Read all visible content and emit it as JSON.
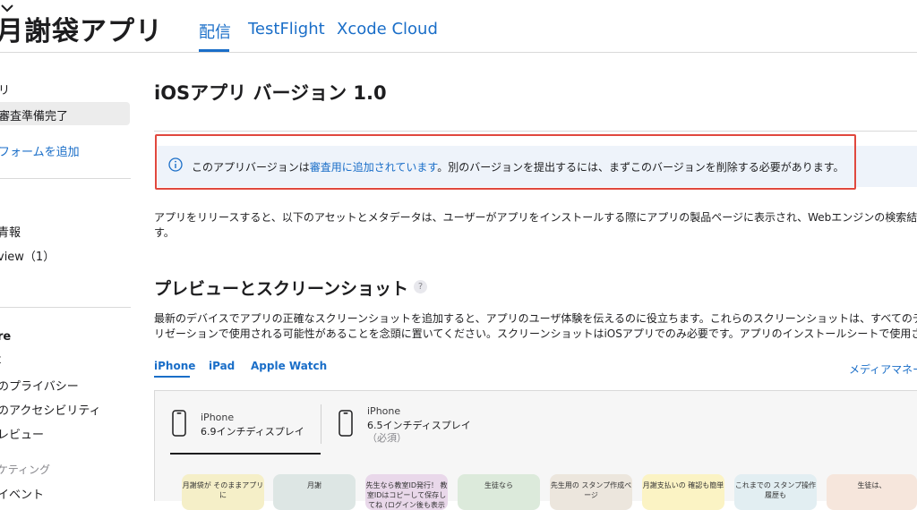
{
  "header": {
    "app_name": "月謝袋アプリ",
    "tabs": [
      {
        "label": "配信"
      },
      {
        "label": "TestFlight"
      },
      {
        "label": "Xcode Cloud"
      }
    ]
  },
  "sidebar": {
    "app_label": "リ",
    "status": "審査準備完了",
    "add_platform": "フォームを追加",
    "items": [
      {
        "label": "青報"
      },
      {
        "label": "view（1）"
      },
      {
        "label": "re"
      },
      {
        "label": "t"
      },
      {
        "label": "のプライバシー"
      },
      {
        "label": "のアクセシビリティ"
      },
      {
        "label": "レビュー"
      },
      {
        "label": "ケティング"
      },
      {
        "label": "イベント"
      }
    ]
  },
  "main": {
    "title": "iOSアプリ バージョン 1.0",
    "banner": {
      "pre": "このアプリバージョンは",
      "link": "審査用に追加されています",
      "post": "。別のバージョンを提出するには、まずこのバージョンを削除する必要があります。"
    },
    "intro_line1": "アプリをリリースすると、以下のアセットとメタデータは、ユーザーがアプリをインストールする際にアプリの製品ページに表示され、Webエンジンの検索結果",
    "intro_line2": "す。",
    "section_title": "プレビューとスクリーンショット",
    "help": "?",
    "section_desc_line1": "最新のデバイスでアプリの正確なスクリーンショットを追加すると、アプリのユーザ体験を伝えるのに役立ちます。これらのスクリーンショットは、すべてのディ",
    "section_desc_line2": "リゼーションで使用される可能性があることを念頭に置いてください。スクリーンショットはiOSアプリでのみ必要です。アプリのインストールシートで使用され",
    "device_tabs": [
      {
        "label": "iPhone"
      },
      {
        "label": "iPad"
      },
      {
        "label": "Apple Watch"
      }
    ],
    "media_manager": "メディアマネー",
    "display_sizes": [
      {
        "device": "iPhone",
        "desc": "6.9インチディスプレイ",
        "note": ""
      },
      {
        "device": "iPhone",
        "desc": "6.5インチディスプレイ",
        "note": "（必須）"
      }
    ],
    "screenshots": [
      {
        "text": "月謝袋が そのままアプリに",
        "color": "#f5efc8"
      },
      {
        "text": "月謝",
        "color": "#dde6e4"
      },
      {
        "text": "先生なら教室ID発行！ 教室IDはコピーして保存してね (ログイン後も表示あり)",
        "color": "#e9d8ea"
      },
      {
        "text": "生徒なら",
        "color": "#dceadb"
      },
      {
        "text": "先生用の スタンプ作成ページ",
        "color": "#ece6dd"
      },
      {
        "text": "月謝支払いの 確認も簡単",
        "color": "#fbf3c4"
      },
      {
        "text": "これまでの スタンプ操作履歴も",
        "color": "#e2eef2"
      },
      {
        "text": "生徒は、",
        "color": "#f6e6dc"
      }
    ]
  },
  "colors": {
    "accent": "#1a6ec8",
    "highlight": "#e0483e",
    "banner_bg": "#eef3fa"
  }
}
